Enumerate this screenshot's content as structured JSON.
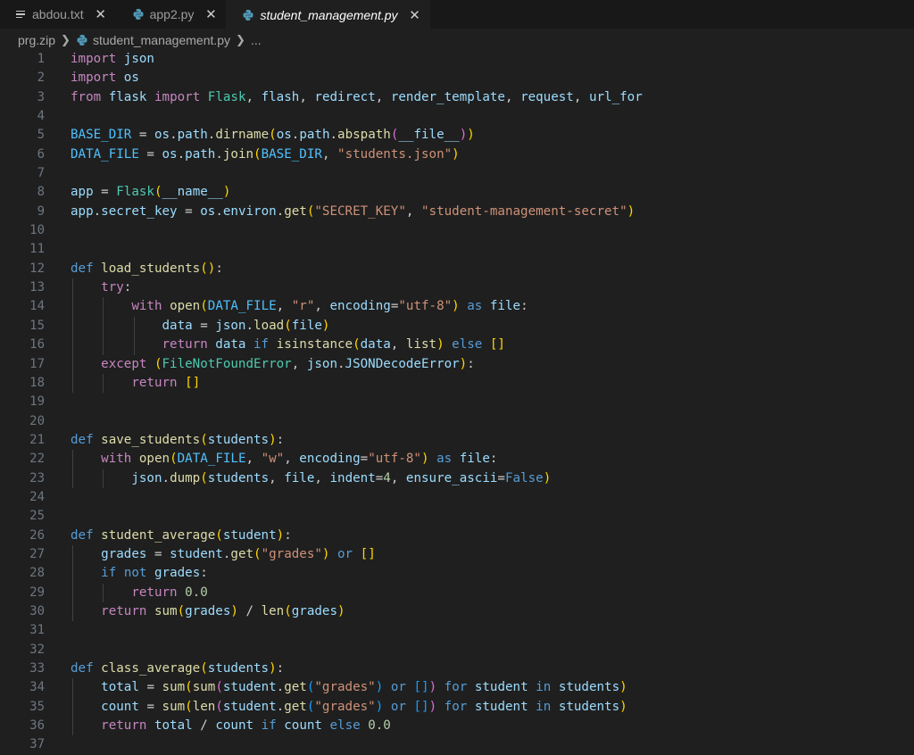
{
  "tabs": [
    {
      "label": "abdou.txt",
      "icon": "text-file-icon",
      "active": false
    },
    {
      "label": "app2.py",
      "icon": "python-icon",
      "active": false
    },
    {
      "label": "student_management.py",
      "icon": "python-icon",
      "active": true
    }
  ],
  "breadcrumb": {
    "root": "prg.zip",
    "file": "student_management.py",
    "more": "..."
  },
  "colors": {
    "background": "#1f1f1f",
    "keyword": "#c586c0",
    "function": "#dcdcaa",
    "string": "#ce9178",
    "variable": "#9cdcfe"
  },
  "code_lines": [
    {
      "n": "1",
      "text": "import json"
    },
    {
      "n": "2",
      "text": "import os"
    },
    {
      "n": "3",
      "text": "from flask import Flask, flash, redirect, render_template, request, url_for"
    },
    {
      "n": "4",
      "text": ""
    },
    {
      "n": "5",
      "text": "BASE_DIR = os.path.dirname(os.path.abspath(__file__))"
    },
    {
      "n": "6",
      "text": "DATA_FILE = os.path.join(BASE_DIR, \"students.json\")"
    },
    {
      "n": "7",
      "text": ""
    },
    {
      "n": "8",
      "text": "app = Flask(__name__)"
    },
    {
      "n": "9",
      "text": "app.secret_key = os.environ.get(\"SECRET_KEY\", \"student-management-secret\")"
    },
    {
      "n": "10",
      "text": ""
    },
    {
      "n": "11",
      "text": ""
    },
    {
      "n": "12",
      "text": "def load_students():"
    },
    {
      "n": "13",
      "text": "    try:"
    },
    {
      "n": "14",
      "text": "        with open(DATA_FILE, \"r\", encoding=\"utf-8\") as file:"
    },
    {
      "n": "15",
      "text": "            data = json.load(file)"
    },
    {
      "n": "16",
      "text": "            return data if isinstance(data, list) else []"
    },
    {
      "n": "17",
      "text": "    except (FileNotFoundError, json.JSONDecodeError):"
    },
    {
      "n": "18",
      "text": "        return []"
    },
    {
      "n": "19",
      "text": ""
    },
    {
      "n": "20",
      "text": ""
    },
    {
      "n": "21",
      "text": "def save_students(students):"
    },
    {
      "n": "22",
      "text": "    with open(DATA_FILE, \"w\", encoding=\"utf-8\") as file:"
    },
    {
      "n": "23",
      "text": "        json.dump(students, file, indent=4, ensure_ascii=False)"
    },
    {
      "n": "24",
      "text": ""
    },
    {
      "n": "25",
      "text": ""
    },
    {
      "n": "26",
      "text": "def student_average(student):"
    },
    {
      "n": "27",
      "text": "    grades = student.get(\"grades\") or []"
    },
    {
      "n": "28",
      "text": "    if not grades:"
    },
    {
      "n": "29",
      "text": "        return 0.0"
    },
    {
      "n": "30",
      "text": "    return sum(grades) / len(grades)"
    },
    {
      "n": "31",
      "text": ""
    },
    {
      "n": "32",
      "text": ""
    },
    {
      "n": "33",
      "text": "def class_average(students):"
    },
    {
      "n": "34",
      "text": "    total = sum(sum(student.get(\"grades\") or []) for student in students)"
    },
    {
      "n": "35",
      "text": "    count = sum(len(student.get(\"grades\") or []) for student in students)"
    },
    {
      "n": "36",
      "text": "    return total / count if count else 0.0"
    },
    {
      "n": "37",
      "text": ""
    }
  ]
}
